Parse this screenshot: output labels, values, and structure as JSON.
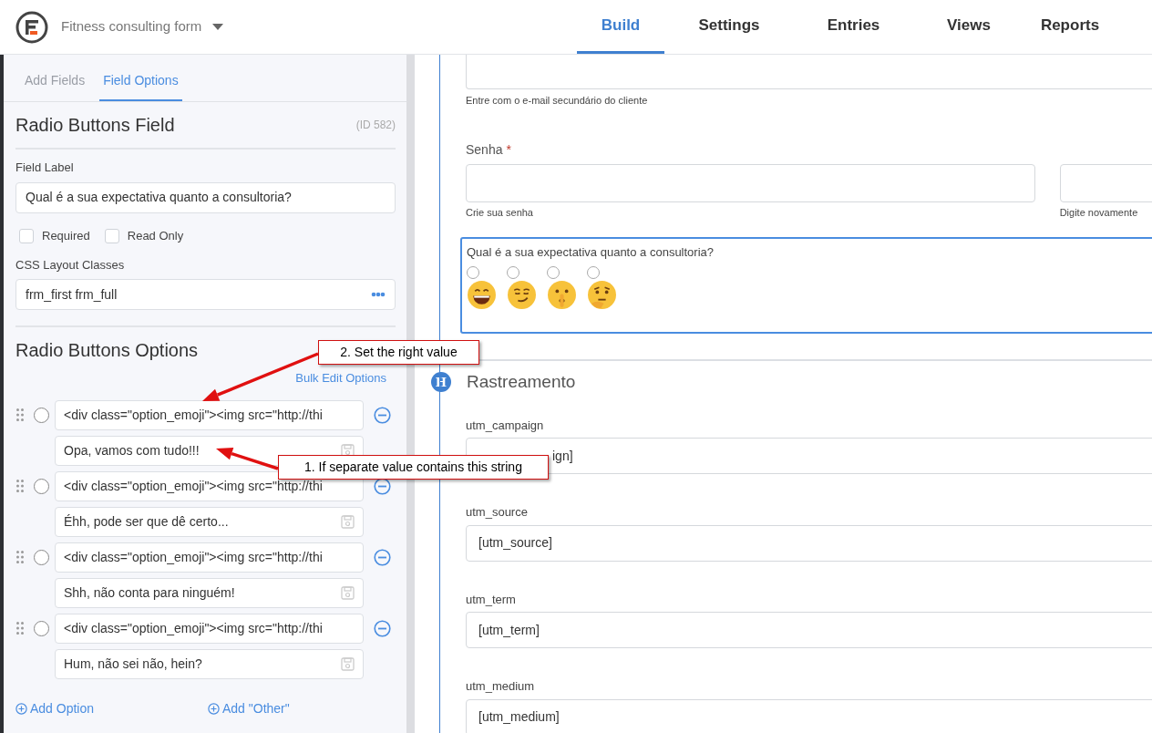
{
  "header": {
    "form_title": "Fitness consulting form",
    "tabs": [
      {
        "label": "Build",
        "selected": true
      },
      {
        "label": "Settings",
        "selected": false
      },
      {
        "label": "Entries",
        "selected": false
      },
      {
        "label": "Views",
        "selected": false
      },
      {
        "label": "Reports",
        "selected": false
      }
    ]
  },
  "sidebar": {
    "tabs": [
      {
        "label": "Add Fields",
        "selected": false
      },
      {
        "label": "Field Options",
        "selected": true
      }
    ],
    "field_title": "Radio Buttons Field",
    "field_id": "(ID 582)",
    "field_label": {
      "label": "Field Label",
      "value": "Qual é a sua expectativa quanto a consultoria?"
    },
    "checkboxes": [
      {
        "label": "Required",
        "checked": false
      },
      {
        "label": "Read Only",
        "checked": false
      }
    ],
    "css_classes": {
      "label": "CSS Layout Classes",
      "value": "frm_first frm_full"
    },
    "options_title": "Radio Buttons Options",
    "bulk_edit": "Bulk Edit Options",
    "options": [
      {
        "label": "<div class=\"option_emoji\"><img src=\"http://thi",
        "value": "Opa, vamos com tudo!!!",
        "selected": false
      },
      {
        "label": "<div class=\"option_emoji\"><img src=\"http://thi",
        "value": "Éhh, pode ser que dê certo...",
        "selected": false
      },
      {
        "label": "<div class=\"option_emoji\"><img src=\"http://thi",
        "value": "Shh, não conta para ninguém!",
        "selected": false
      },
      {
        "label": "<div class=\"option_emoji\"><img src=\"http://thi",
        "value": "Hum, não sei não, hein?",
        "selected": false
      }
    ],
    "add_option": "Add Option",
    "add_other": "Add \"Other\""
  },
  "canvas": {
    "email_help": "Entre com o e-mail secundário do cliente",
    "password": {
      "label": "Senha",
      "required_mark": "*",
      "help": "Crie sua senha"
    },
    "confirm_help": "Digite novamente",
    "radio_field": {
      "label": "Qual é a sua expectativa quanto a consultoria?",
      "options": [
        {
          "kind": "grin",
          "selected": false
        },
        {
          "kind": "smirk",
          "selected": false
        },
        {
          "kind": "shush",
          "selected": false
        },
        {
          "kind": "think",
          "selected": false
        }
      ]
    },
    "section": {
      "icon": "H",
      "title": "Rastreamento"
    },
    "utm_fields": [
      {
        "label": "utm_campaign",
        "value": "ign]"
      },
      {
        "label": "utm_source",
        "value": "[utm_source]"
      },
      {
        "label": "utm_term",
        "value": "[utm_term]"
      },
      {
        "label": "utm_medium",
        "value": "[utm_medium]"
      }
    ]
  },
  "annotations": [
    {
      "text": "2. Set the right value"
    },
    {
      "text": "1. If separate value contains this string"
    }
  ]
}
